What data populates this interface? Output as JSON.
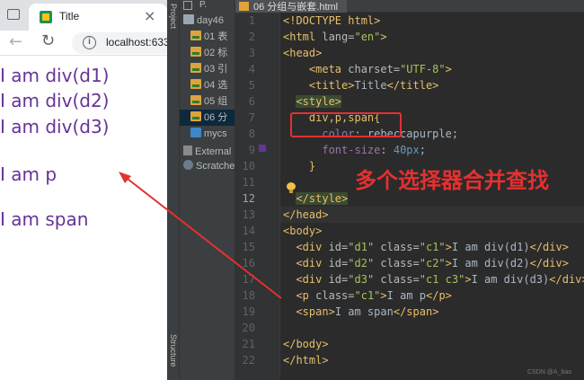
{
  "browser": {
    "tab_title": "Title",
    "tab_close": "×",
    "back_glyph": "←",
    "reload_glyph": "↻",
    "info_glyph": "i",
    "url": "localhost:633",
    "content": [
      "I am div(d1)",
      "I am div(d2)",
      "I am div(d3)",
      "I am p",
      "I am span"
    ],
    "text_color": "#663399"
  },
  "ide": {
    "strip_top": "Project",
    "strip_bottom": "Structure",
    "project_header": "P.",
    "tree": [
      {
        "label": "day46",
        "icon": "folder-icon"
      },
      {
        "label": "01 表",
        "icon": "html-file-icon"
      },
      {
        "label": "02 标",
        "icon": "html-file-icon"
      },
      {
        "label": "03 引",
        "icon": "html-file-icon"
      },
      {
        "label": "04 选",
        "icon": "html-file-icon"
      },
      {
        "label": "05 组",
        "icon": "html-file-icon"
      },
      {
        "label": "06 分",
        "icon": "html-file-icon"
      },
      {
        "label": "mycs",
        "icon": "css-file-icon"
      },
      {
        "label": "External",
        "icon": "library-icon"
      },
      {
        "label": "Scratche",
        "icon": "scratch-icon"
      }
    ],
    "editor_tab": "06 分组与嵌套.html",
    "line_numbers": [
      "1",
      "2",
      "3",
      "4",
      "5",
      "6",
      "7",
      "8",
      "9",
      "10",
      "11",
      "12",
      "13",
      "14",
      "15",
      "16",
      "17",
      "18",
      "19",
      "20",
      "21",
      "22"
    ],
    "current_line": "12",
    "code": [
      [
        {
          "t": "<!DOCTYPE html>",
          "c": "t-tag"
        }
      ],
      [
        {
          "t": "<html ",
          "c": "t-tag"
        },
        {
          "t": "lang=",
          "c": "t-attr"
        },
        {
          "t": "\"en\"",
          "c": "t-val"
        },
        {
          "t": ">",
          "c": "t-tag"
        }
      ],
      [
        {
          "t": "<head>",
          "c": "t-tag"
        }
      ],
      [
        {
          "t": "    ",
          "c": "t-text"
        },
        {
          "t": "<meta ",
          "c": "t-tag"
        },
        {
          "t": "charset=",
          "c": "t-attr"
        },
        {
          "t": "\"UTF-8\"",
          "c": "t-val"
        },
        {
          "t": ">",
          "c": "t-tag"
        }
      ],
      [
        {
          "t": "    ",
          "c": "t-text"
        },
        {
          "t": "<title>",
          "c": "t-tag"
        },
        {
          "t": "Title",
          "c": "t-text"
        },
        {
          "t": "</title>",
          "c": "t-tag"
        }
      ],
      [
        {
          "t": "  ",
          "c": "t-text"
        },
        {
          "t": "<style>",
          "c": "t-tag t-style-bg"
        }
      ],
      [
        {
          "t": "    ",
          "c": "t-text"
        },
        {
          "t": "div,p,span{",
          "c": "t-sel"
        }
      ],
      [
        {
          "t": "      ",
          "c": "t-text"
        },
        {
          "t": "color",
          "c": "t-prop"
        },
        {
          "t": ": rebeccapurple;",
          "c": "t-text"
        }
      ],
      [
        {
          "t": "      ",
          "c": "t-text"
        },
        {
          "t": "font-size",
          "c": "t-prop"
        },
        {
          "t": ": ",
          "c": "t-text"
        },
        {
          "t": "40px",
          "c": "t-num"
        },
        {
          "t": ";",
          "c": "t-text"
        }
      ],
      [
        {
          "t": "    ",
          "c": "t-text"
        },
        {
          "t": "}",
          "c": "t-sel"
        }
      ],
      [],
      [
        {
          "t": "  ",
          "c": "t-text"
        },
        {
          "t": "</style>",
          "c": "t-tag t-style-bg"
        }
      ],
      [
        {
          "t": "</head>",
          "c": "t-tag"
        }
      ],
      [
        {
          "t": "<body>",
          "c": "t-tag"
        }
      ],
      [
        {
          "t": "  ",
          "c": "t-text"
        },
        {
          "t": "<div ",
          "c": "t-tag"
        },
        {
          "t": "id=",
          "c": "t-attr"
        },
        {
          "t": "\"d1\" ",
          "c": "t-val"
        },
        {
          "t": "class=",
          "c": "t-attr"
        },
        {
          "t": "\"c1\"",
          "c": "t-val"
        },
        {
          "t": ">",
          "c": "t-tag"
        },
        {
          "t": "I am div(d1)",
          "c": "t-text"
        },
        {
          "t": "</div>",
          "c": "t-tag"
        }
      ],
      [
        {
          "t": "  ",
          "c": "t-text"
        },
        {
          "t": "<div ",
          "c": "t-tag"
        },
        {
          "t": "id=",
          "c": "t-attr"
        },
        {
          "t": "\"d2\" ",
          "c": "t-val"
        },
        {
          "t": "class=",
          "c": "t-attr"
        },
        {
          "t": "\"c2\"",
          "c": "t-val"
        },
        {
          "t": ">",
          "c": "t-tag"
        },
        {
          "t": "I am div(d2)",
          "c": "t-text"
        },
        {
          "t": "</div>",
          "c": "t-tag"
        }
      ],
      [
        {
          "t": "  ",
          "c": "t-text"
        },
        {
          "t": "<div ",
          "c": "t-tag"
        },
        {
          "t": "id=",
          "c": "t-attr"
        },
        {
          "t": "\"d3\" ",
          "c": "t-val"
        },
        {
          "t": "class=",
          "c": "t-attr"
        },
        {
          "t": "\"c1 c3\"",
          "c": "t-val"
        },
        {
          "t": ">",
          "c": "t-tag"
        },
        {
          "t": "I am div(d3)",
          "c": "t-text"
        },
        {
          "t": "</div>",
          "c": "t-tag"
        }
      ],
      [
        {
          "t": "  ",
          "c": "t-text"
        },
        {
          "t": "<p ",
          "c": "t-tag"
        },
        {
          "t": "class=",
          "c": "t-attr"
        },
        {
          "t": "\"c1\"",
          "c": "t-val"
        },
        {
          "t": ">",
          "c": "t-tag"
        },
        {
          "t": "I am p",
          "c": "t-text"
        },
        {
          "t": "</p>",
          "c": "t-tag"
        }
      ],
      [
        {
          "t": "  ",
          "c": "t-text"
        },
        {
          "t": "<span>",
          "c": "t-tag"
        },
        {
          "t": "I am span",
          "c": "t-text"
        },
        {
          "t": "</span>",
          "c": "t-tag"
        }
      ],
      [],
      [
        {
          "t": "</body>",
          "c": "t-tag"
        }
      ],
      [
        {
          "t": "</html>",
          "c": "t-tag"
        }
      ]
    ],
    "annotation": "多个选择器合并查找",
    "annotation_color": "#e53030",
    "watermark": "CSDN @A_bao"
  }
}
